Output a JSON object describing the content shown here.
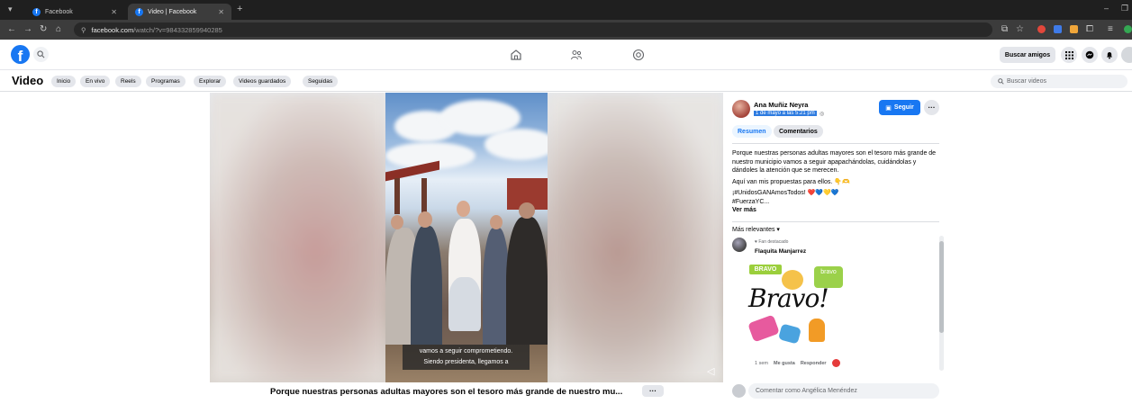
{
  "browser": {
    "tabs": [
      {
        "title": "Facebook",
        "active": false
      },
      {
        "title": "Video | Facebook",
        "active": true
      }
    ],
    "new_tab": "+",
    "url_host": "facebook.com",
    "url_path": "/watch/?v=984332859940285",
    "window_min": "–",
    "colors": {
      "chrome_bg": "#1f1f1f",
      "toolbar_bg": "#3c3c3c"
    }
  },
  "header": {
    "logo": "f",
    "find_friends": "Buscar amigos",
    "accent": "#1877f2"
  },
  "subnav": {
    "title": "Video",
    "pills": [
      "Inicio",
      "En vivo",
      "Reels",
      "Programas",
      "Explorar",
      "Videos guardados",
      "Seguidas"
    ],
    "search_placeholder": "Buscar videos"
  },
  "video": {
    "caption_line1": "vamos a seguir comprometiendo.",
    "caption_line2": "Siendo presidenta, llegamos a",
    "post_title": "Porque nuestras personas adultas mayores son el tesoro más grande de nuestro mu...",
    "more": "···"
  },
  "panel": {
    "author": "Ana Muñiz Neyra",
    "date": "1 de mayo a las 5:21 pm",
    "follow_label": "Seguir",
    "more": "···",
    "tabs": [
      "Resumen",
      "Comentarios"
    ],
    "description": [
      "Porque nuestras personas adultas mayores son el tesoro más grande de nuestro municipio vamos a seguir apapachándolas, cuidándolas y dándoles la atención que se merecen.",
      "Aquí van mis propuestas para ellos. 👇🫶",
      "¡#UnidosGANAmosTodos! ❤️💙💛💙",
      "#FuerzaYC..."
    ],
    "see_more": "Ver más",
    "sort": "Más relevantes ▾",
    "comment": {
      "badge": "Fan destacado",
      "name": "Flaquita Manjarrez",
      "sticker_word": "Bravo!",
      "sticker_tag": "bravo",
      "sticker_bravo": "BRAVO",
      "age": "1 sem",
      "like": "Me gusta",
      "reply": "Responder"
    },
    "compose_placeholder": "Comentar como Angélica Menéndez"
  }
}
